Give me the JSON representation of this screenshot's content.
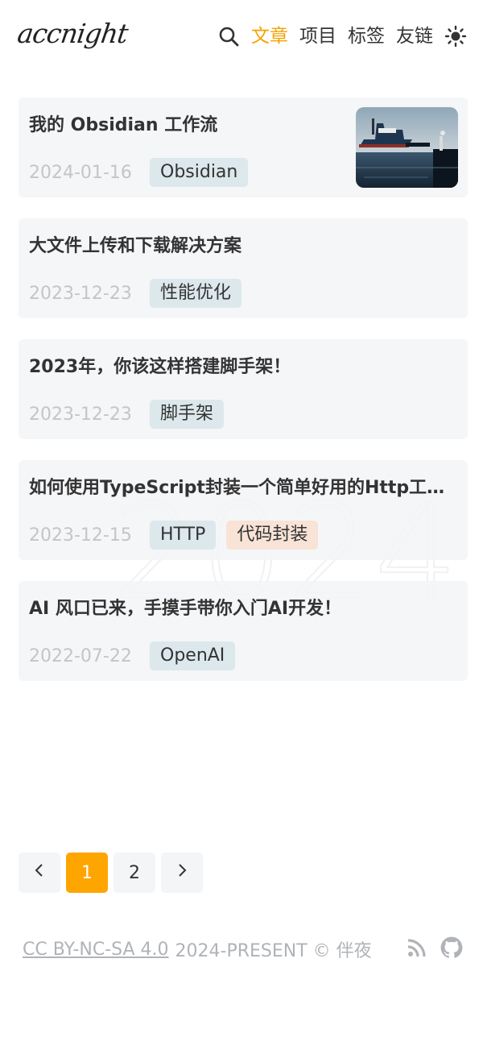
{
  "site": {
    "logo": "accnight"
  },
  "nav": {
    "items": [
      "文章",
      "项目",
      "标签",
      "友链"
    ],
    "active_index": 0
  },
  "posts": [
    {
      "title": "我的 Obsidian 工作流",
      "date": "2024-01-16",
      "tags": [
        "Obsidian"
      ],
      "has_thumbnail": true
    },
    {
      "title": "大文件上传和下载解决方案",
      "date": "2023-12-23",
      "tags": [
        "性能优化"
      ]
    },
    {
      "title": "2023年，你该这样搭建脚手架！",
      "date": "2023-12-23",
      "tags": [
        "脚手架"
      ]
    },
    {
      "title": "如何使用TypeScript封装一个简单好用的Http工…",
      "date": "2023-12-15",
      "tags": [
        "HTTP",
        "代码封装"
      ]
    },
    {
      "title": "AI 风口已来，手摸手带你入门AI开发！",
      "date": "2022-07-22",
      "tags": [
        "OpenAI"
      ]
    }
  ],
  "watermark": "2024",
  "pagination": {
    "pages": [
      "1",
      "2"
    ],
    "current": "1",
    "prev": "‹",
    "next": "›"
  },
  "footer": {
    "license": "CC BY-NC-SA 4.0",
    "copyright": "2024-PRESENT © 伴夜"
  },
  "colors": {
    "accent": "#f5a300",
    "tag": "#dde8ec",
    "tag_warm": "#f8e3d6",
    "card": "#f3f5f7"
  }
}
